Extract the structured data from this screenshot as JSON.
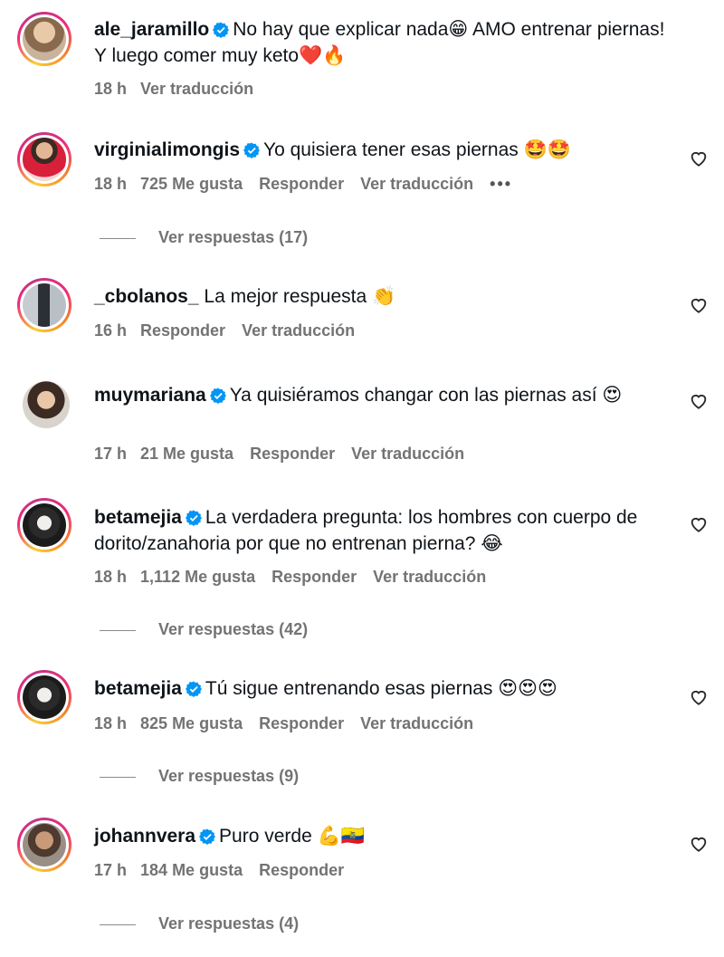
{
  "comments": [
    {
      "username": "ale_jaramillo",
      "verified": true,
      "text": "No hay que explicar nada😁 AMO entrenar piernas! Y luego comer muy keto❤️🔥",
      "time": "18 h",
      "likes": "",
      "reply_label": "",
      "translate_label": "Ver traducción",
      "view_replies": ""
    },
    {
      "username": "virginialimongis",
      "verified": true,
      "text": "Yo quisiera tener esas piernas 🤩🤩",
      "time": "18 h",
      "likes": "725 Me gusta",
      "reply_label": "Responder",
      "translate_label": "Ver traducción",
      "more": "•••",
      "view_replies": "Ver respuestas (17)"
    },
    {
      "username": "_cbolanos_",
      "verified": false,
      "text": "La mejor respuesta 👏",
      "time": "16 h",
      "likes": "",
      "reply_label": "Responder",
      "translate_label": "Ver traducción",
      "view_replies": ""
    },
    {
      "username": "muymariana",
      "verified": true,
      "text": "Ya quisiéramos changar con las piernas así 😍",
      "time": "17 h",
      "likes": "21 Me gusta",
      "reply_label": "Responder",
      "translate_label": "Ver traducción",
      "view_replies": ""
    },
    {
      "username": "betamejia",
      "verified": true,
      "text": "La verdadera pregunta: los hombres con cuerpo de dorito/zanahoria por que no entrenan pierna? 😂",
      "time": "18 h",
      "likes": "1,112 Me gusta",
      "reply_label": "Responder",
      "translate_label": "Ver traducción",
      "view_replies": "Ver respuestas (42)"
    },
    {
      "username": "betamejia",
      "verified": true,
      "text": "Tú sigue entrenando esas piernas 😍😍😍",
      "time": "18 h",
      "likes": "825 Me gusta",
      "reply_label": "Responder",
      "translate_label": "Ver traducción",
      "view_replies": "Ver respuestas (9)"
    },
    {
      "username": "johannvera",
      "verified": true,
      "text": "Puro verde 💪🇪🇨",
      "time": "17 h",
      "likes": "184 Me gusta",
      "reply_label": "Responder",
      "translate_label": "",
      "view_replies": "Ver respuestas (4)"
    }
  ],
  "icons": {
    "verified": "verified-badge-icon",
    "heart": "heart-outline-icon"
  },
  "colors": {
    "verified_blue": "#0095f6",
    "meta_gray": "#737373"
  }
}
